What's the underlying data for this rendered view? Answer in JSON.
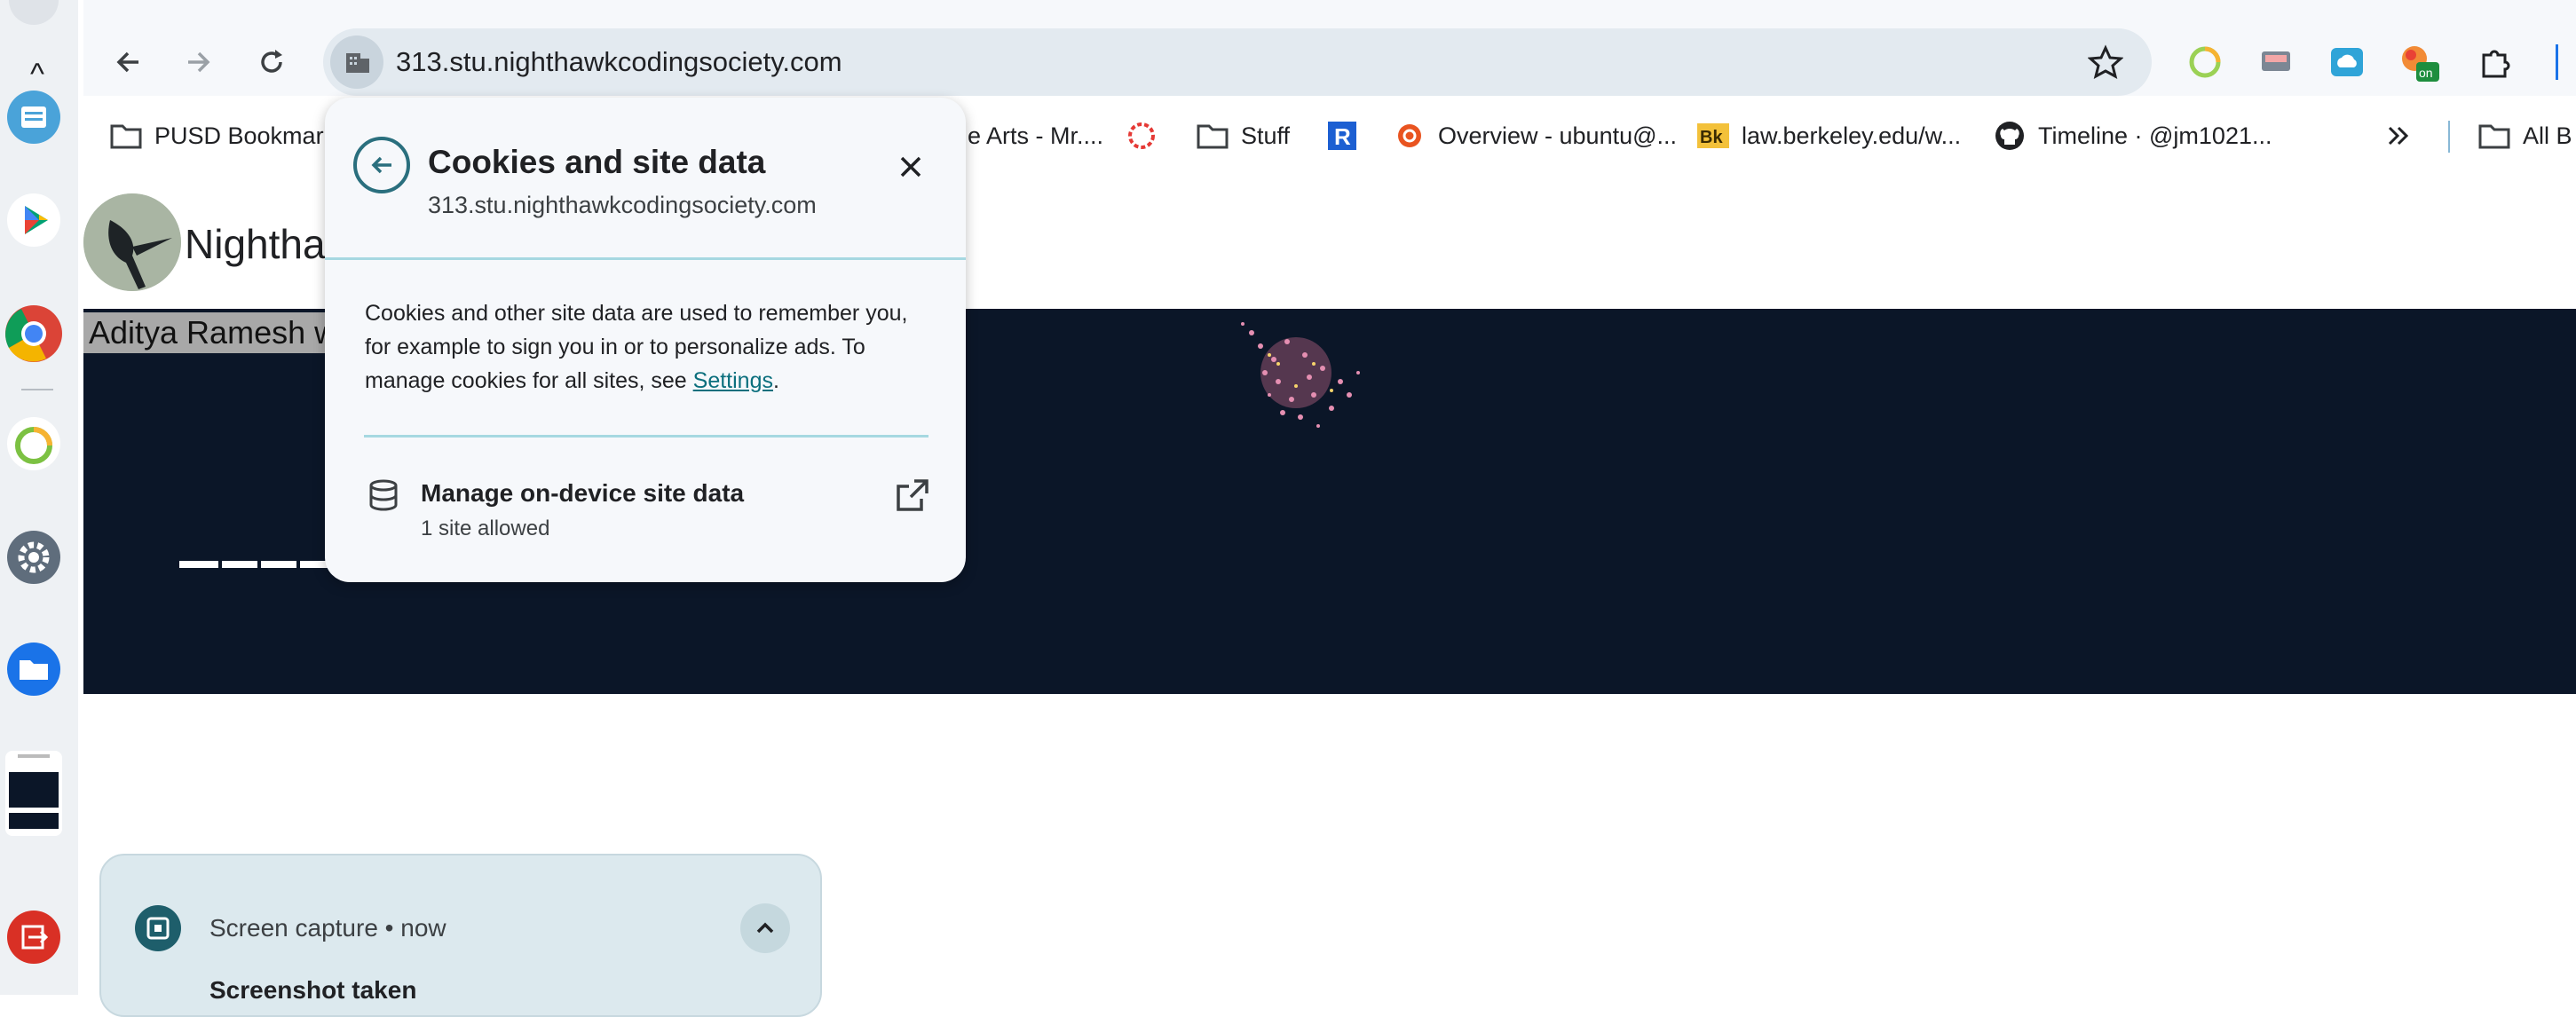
{
  "browser": {
    "url": "313.stu.nighthawkcodingsociety.com"
  },
  "bookmarks": [
    {
      "label": "PUSD Bookmar",
      "icon": "folder-icon"
    },
    {
      "label": "e Arts - Mr....",
      "icon": ""
    },
    {
      "label": "",
      "icon": "red-circle-icon"
    },
    {
      "label": "Stuff",
      "icon": "folder-icon"
    },
    {
      "label": "",
      "icon": "replit-icon"
    },
    {
      "label": "Overview - ubuntu@...",
      "icon": "ubuntu-icon"
    },
    {
      "label": "law.berkeley.edu/w...",
      "icon": "bk-icon"
    },
    {
      "label": "Timeline · @jm1021...",
      "icon": "github-icon"
    },
    {
      "label": "All B",
      "icon": "folder-icon"
    }
  ],
  "page": {
    "site_title": "Nighthа",
    "author_label": "Aditya Ramesh w"
  },
  "popup": {
    "title": "Cookies and site data",
    "domain": "313.stu.nighthawkcodingsociety.com",
    "desc_text": "Cookies and other site data are used to remember you, for example to sign you in or to personalize ads. To manage cookies for all sites, see ",
    "settings_link": "Settings",
    "desc_end": ".",
    "manage_title": "Manage on-device site data",
    "manage_sub": "1 site allowed"
  },
  "notification": {
    "app_name": "Screen capture",
    "separator": "•",
    "time": "now",
    "message": "Screenshot taken"
  },
  "colors": {
    "hero_bg": "#0b1628",
    "accent": "#2a6f7e",
    "popup_bg": "#f6f8fb"
  }
}
